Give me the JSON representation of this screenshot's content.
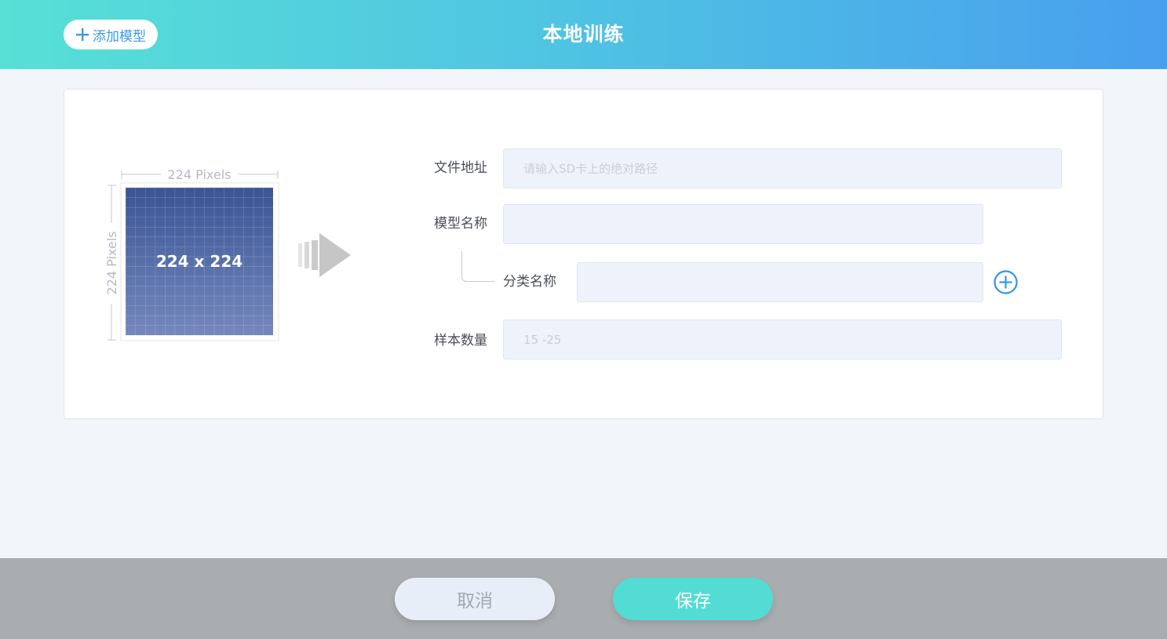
{
  "header": {
    "add_model_label": "添加模型",
    "title": "本地训练"
  },
  "illustration": {
    "width_label": "224 Pixels",
    "height_label": "224 Pixels",
    "size_label": "224 x 224"
  },
  "form": {
    "file_path": {
      "label": "文件地址",
      "placeholder": "请输入SD卡上的绝对路径",
      "value": ""
    },
    "model_name": {
      "label": "模型名称",
      "value": ""
    },
    "category_name": {
      "label": "分类名称",
      "value": ""
    },
    "sample_count": {
      "label": "样本数量",
      "placeholder": "15 -25",
      "value": ""
    }
  },
  "footer": {
    "cancel_label": "取消",
    "save_label": "保存"
  },
  "icons": {
    "add_model": "plus-icon",
    "add_category": "circle-plus-icon",
    "flow": "arrow-right-icon"
  },
  "colors": {
    "header_gradient_start": "#57e0d6",
    "header_gradient_end": "#489fee",
    "accent": "#3a9be8",
    "save_button": "#52dcd3",
    "cancel_button": "#e8eef8",
    "footer_bar": "#a9adb0"
  }
}
